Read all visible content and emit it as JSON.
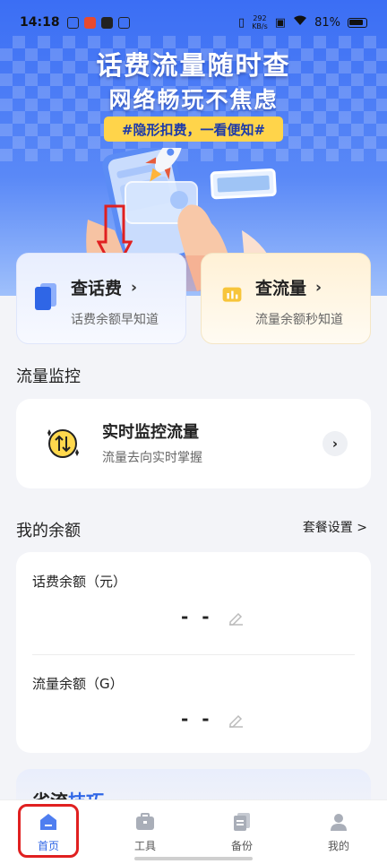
{
  "status_bar": {
    "time": "14:18",
    "net_speed_top": "292",
    "net_speed_bottom": "KB/s",
    "battery": "81%"
  },
  "banner": {
    "title_line1": "话费流量随时查",
    "title_line2": "网络畅玩不焦虑",
    "tag": "#隐形扣费，一看便知#"
  },
  "quick_actions": [
    {
      "title": "查话费",
      "subtitle": "话费余额早知道"
    },
    {
      "title": "查流量",
      "subtitle": "流量余额秒知道"
    }
  ],
  "monitor_section": {
    "heading": "流量监控",
    "item_title": "实时监控流量",
    "item_subtitle": "流量去向实时掌握"
  },
  "balance_section": {
    "heading": "我的余额",
    "settings_link": "套餐设置 >",
    "phone_label": "话费余额（元）",
    "phone_value": "- -",
    "data_label": "流量余额（G）",
    "data_value": "- -"
  },
  "tips": {
    "title_part1": "省流",
    "title_part2": "技巧"
  },
  "tabs": [
    {
      "label": "首页",
      "icon": "home-icon"
    },
    {
      "label": "工具",
      "icon": "toolbox-icon"
    },
    {
      "label": "备份",
      "icon": "backup-icon"
    },
    {
      "label": "我的",
      "icon": "profile-icon"
    }
  ],
  "colors": {
    "accent": "#2f66e6",
    "highlight": "#e02020",
    "tag_bg": "#ffd44a"
  }
}
